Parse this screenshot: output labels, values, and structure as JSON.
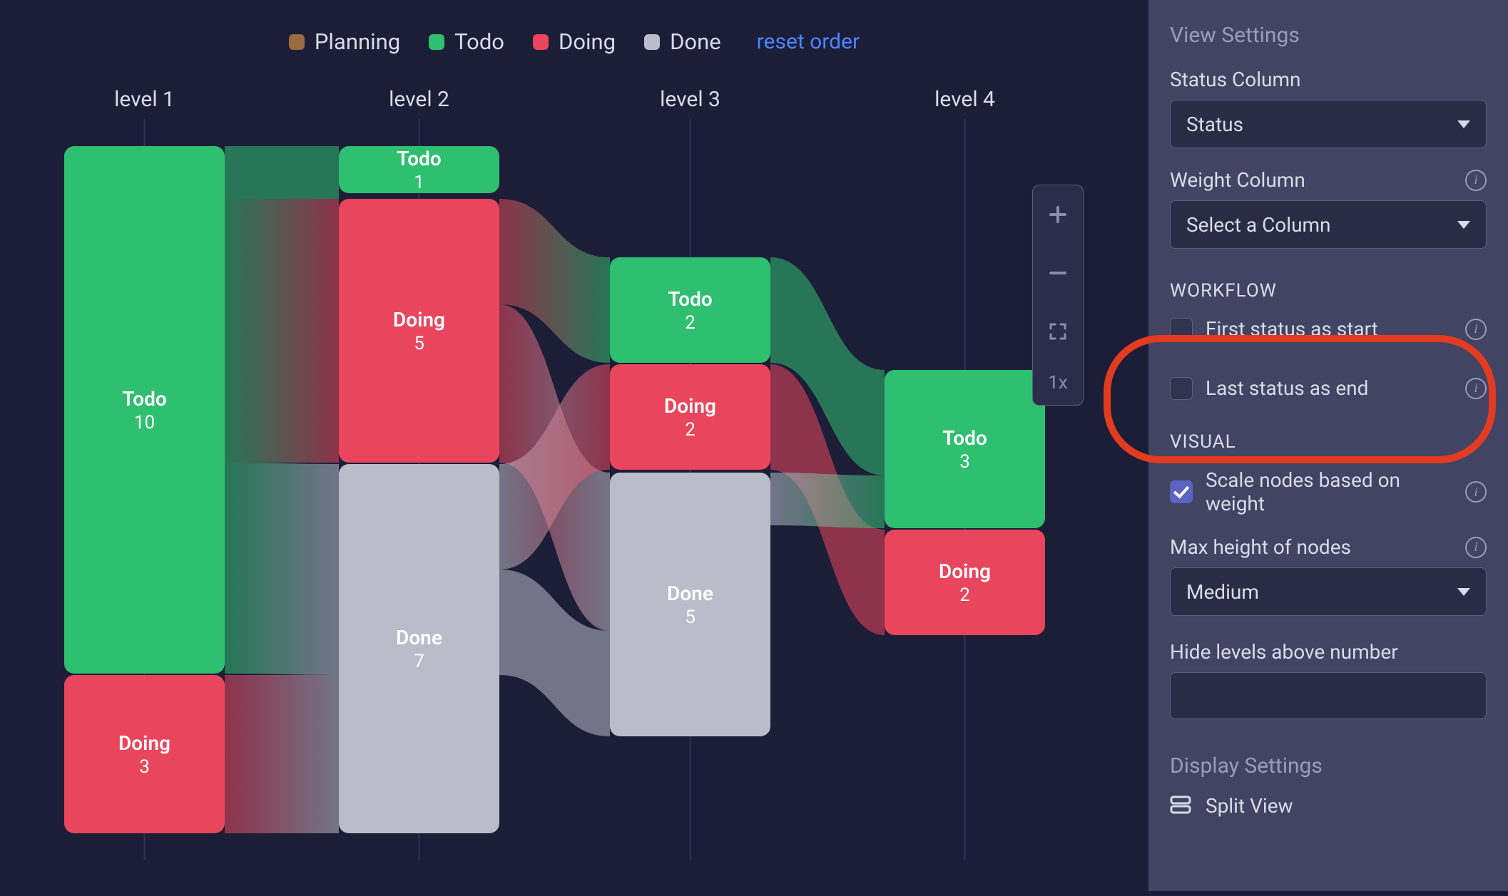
{
  "legend": [
    {
      "label": "Planning",
      "color": "#9a6b41"
    },
    {
      "label": "Todo",
      "color": "#2fbf71"
    },
    {
      "label": "Doing",
      "color": "#e9455c"
    },
    {
      "label": "Done",
      "color": "#babcc9"
    }
  ],
  "reset_label": "reset order",
  "columns": [
    "level 1",
    "level 2",
    "level 3",
    "level 4"
  ],
  "zoom": {
    "label": "1x"
  },
  "settings": {
    "view_settings_title": "View Settings",
    "status_column_label": "Status Column",
    "status_column_value": "Status",
    "weight_column_label": "Weight Column",
    "weight_column_value": "Select a Column",
    "workflow_title": "WORKFLOW",
    "first_status_label": "First status as start",
    "first_status_checked": false,
    "last_status_label": "Last status as end",
    "last_status_checked": false,
    "visual_title": "VISUAL",
    "scale_nodes_label": "Scale nodes based on weight",
    "scale_nodes_checked": true,
    "max_height_label": "Max height of nodes",
    "max_height_value": "Medium",
    "hide_levels_label": "Hide levels above number",
    "hide_levels_value": "",
    "display_settings_title": "Display Settings",
    "split_view_label": "Split View"
  },
  "chart_data": {
    "type": "sankey",
    "levels": [
      "level 1",
      "level 2",
      "level 3",
      "level 4"
    ],
    "nodes": [
      {
        "level": 1,
        "status": "Todo",
        "value": 10
      },
      {
        "level": 1,
        "status": "Doing",
        "value": 3
      },
      {
        "level": 2,
        "status": "Todo",
        "value": 1
      },
      {
        "level": 2,
        "status": "Doing",
        "value": 5
      },
      {
        "level": 2,
        "status": "Done",
        "value": 7
      },
      {
        "level": 3,
        "status": "Todo",
        "value": 2
      },
      {
        "level": 3,
        "status": "Doing",
        "value": 2
      },
      {
        "level": 3,
        "status": "Done",
        "value": 5
      },
      {
        "level": 4,
        "status": "Todo",
        "value": 3
      },
      {
        "level": 4,
        "status": "Doing",
        "value": 2
      }
    ],
    "links": [
      {
        "from": {
          "level": 1,
          "status": "Todo"
        },
        "to": {
          "level": 2,
          "status": "Todo"
        },
        "value": 1
      },
      {
        "from": {
          "level": 1,
          "status": "Todo"
        },
        "to": {
          "level": 2,
          "status": "Doing"
        },
        "value": 5
      },
      {
        "from": {
          "level": 1,
          "status": "Todo"
        },
        "to": {
          "level": 2,
          "status": "Done"
        },
        "value": 4
      },
      {
        "from": {
          "level": 1,
          "status": "Doing"
        },
        "to": {
          "level": 2,
          "status": "Done"
        },
        "value": 3
      },
      {
        "from": {
          "level": 2,
          "status": "Doing"
        },
        "to": {
          "level": 3,
          "status": "Todo"
        },
        "value": 2
      },
      {
        "from": {
          "level": 2,
          "status": "Doing"
        },
        "to": {
          "level": 3,
          "status": "Done"
        },
        "value": 3
      },
      {
        "from": {
          "level": 2,
          "status": "Done"
        },
        "to": {
          "level": 3,
          "status": "Doing"
        },
        "value": 2
      },
      {
        "from": {
          "level": 2,
          "status": "Done"
        },
        "to": {
          "level": 3,
          "status": "Done"
        },
        "value": 2
      },
      {
        "from": {
          "level": 3,
          "status": "Todo"
        },
        "to": {
          "level": 4,
          "status": "Todo"
        },
        "value": 2
      },
      {
        "from": {
          "level": 3,
          "status": "Doing"
        },
        "to": {
          "level": 4,
          "status": "Doing"
        },
        "value": 2
      },
      {
        "from": {
          "level": 3,
          "status": "Done"
        },
        "to": {
          "level": 4,
          "status": "Todo"
        },
        "value": 1
      }
    ]
  }
}
